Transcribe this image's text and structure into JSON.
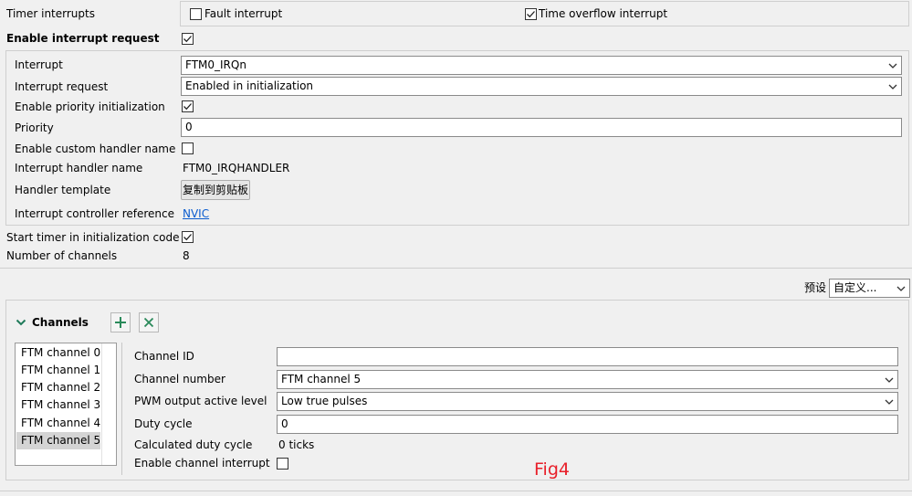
{
  "top": {
    "timer_interrupts_label": "Timer interrupts",
    "fault_interrupt_label": "Fault interrupt",
    "fault_interrupt_checked": false,
    "time_overflow_label": "Time overflow interrupt",
    "time_overflow_checked": true,
    "enable_interrupt_request_label": "Enable interrupt request",
    "enable_interrupt_request_checked": true
  },
  "interrupt": {
    "interrupt_label": "Interrupt",
    "interrupt_value": "FTM0_IRQn",
    "interrupt_request_label": "Interrupt request",
    "interrupt_request_value": "Enabled in initialization",
    "enable_priority_label": "Enable priority initialization",
    "enable_priority_checked": true,
    "priority_label": "Priority",
    "priority_value": "0",
    "custom_handler_label": "Enable custom handler name",
    "custom_handler_checked": false,
    "handler_name_label": "Interrupt handler name",
    "handler_name_value": "FTM0_IRQHANDLER",
    "handler_template_label": "Handler template",
    "copy_button_label": "复制到剪贴板",
    "controller_ref_label": "Interrupt controller reference",
    "controller_ref_link": "NVIC"
  },
  "timer": {
    "start_timer_label": "Start timer in initialization code",
    "start_timer_checked": true,
    "num_channels_label": "Number of channels",
    "num_channels_value": "8"
  },
  "preset": {
    "label": "预设",
    "value": "自定义..."
  },
  "channels": {
    "title": "Channels",
    "list": [
      "FTM channel 0",
      "FTM channel 1",
      "FTM channel 2",
      "FTM channel 3",
      "FTM channel 4",
      "FTM channel 5"
    ],
    "selected_index": 5,
    "channel_id_label": "Channel ID",
    "channel_id_value": "",
    "channel_number_label": "Channel number",
    "channel_number_value": "FTM channel 5",
    "pwm_label": "PWM output active level",
    "pwm_value": "Low true pulses",
    "duty_cycle_label": "Duty cycle",
    "duty_cycle_value": "0",
    "calc_duty_label": "Calculated duty cycle",
    "calc_duty_value": "0 ticks",
    "enable_channel_int_label": "Enable channel interrupt",
    "enable_channel_int_checked": false
  },
  "annotation": {
    "text": "Fig4",
    "color": "#e8202a"
  }
}
